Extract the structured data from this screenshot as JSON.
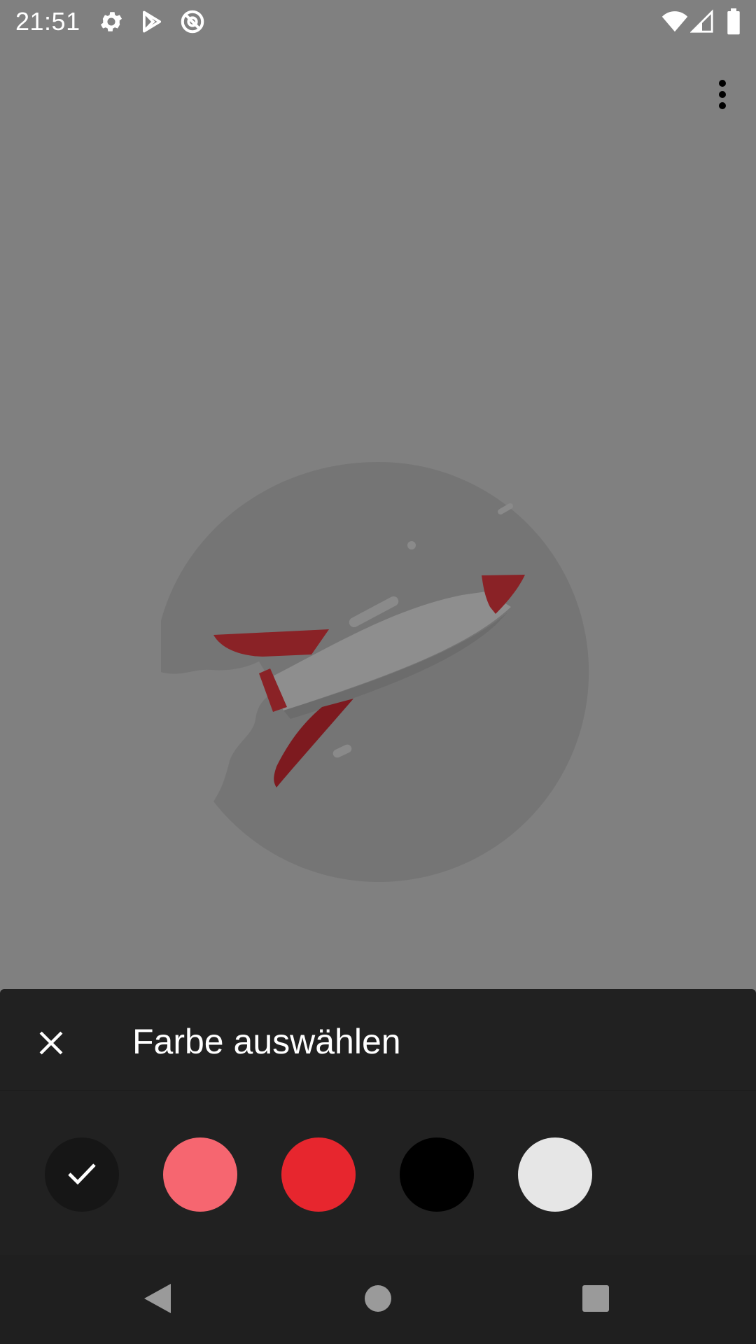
{
  "status_bar": {
    "time": "21:51",
    "icons_left": [
      "settings-icon",
      "play-store-icon",
      "no-sync-icon"
    ],
    "icons_right": [
      "wifi-icon",
      "cellular-signal-icon",
      "battery-icon"
    ]
  },
  "toolbar": {
    "overflow_icon": "more-vert-icon"
  },
  "illustration": {
    "subject": "rocket-illustration"
  },
  "sheet": {
    "title": "Farbe auswählen",
    "close_icon": "close-icon",
    "swatches": [
      {
        "color": "#161616",
        "selected": true,
        "check_icon": "check-icon"
      },
      {
        "color": "#f66670",
        "selected": false
      },
      {
        "color": "#e7262e",
        "selected": false
      },
      {
        "color": "#000000",
        "selected": false
      },
      {
        "color": "#e6e6e6",
        "selected": false
      }
    ]
  },
  "nav_bar": {
    "back_icon": "back-icon",
    "home_icon": "home-icon",
    "recents_icon": "recents-icon"
  },
  "colors": {
    "scrim": "#808080",
    "sheet_bg": "#212121",
    "nav_bg": "#1f1f1f",
    "accent_red": "#e7262e"
  }
}
